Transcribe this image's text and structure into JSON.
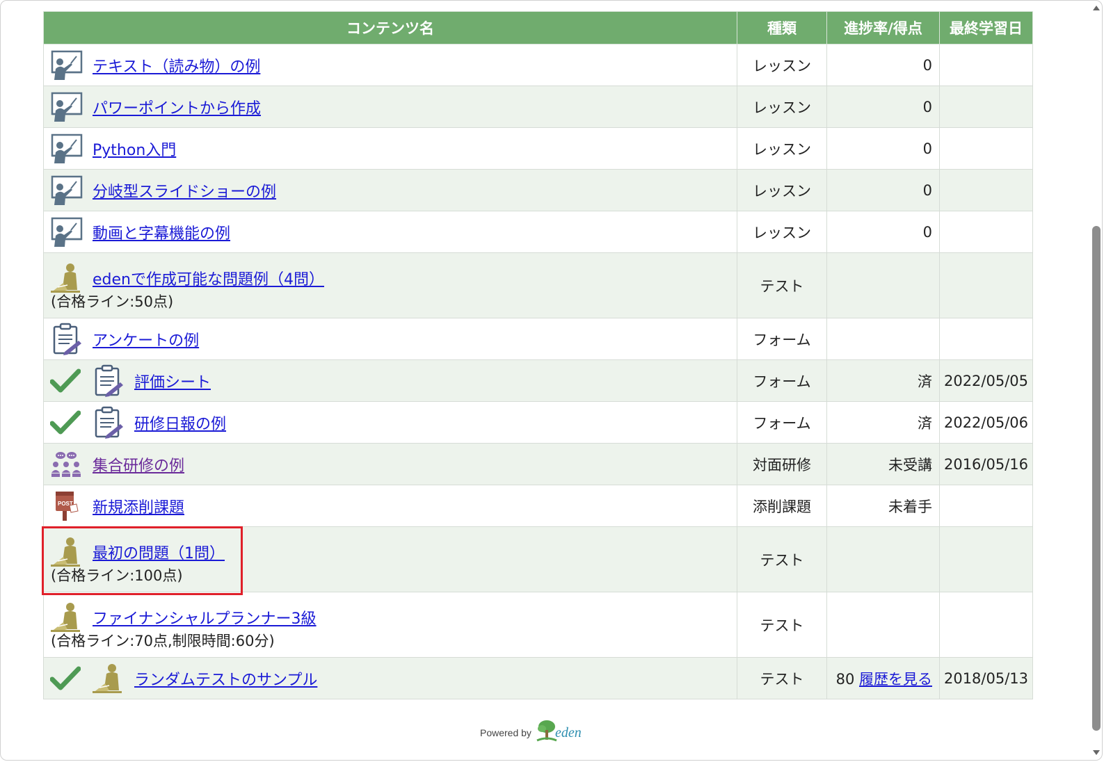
{
  "table": {
    "headers": {
      "name": "コンテンツ名",
      "type": "種類",
      "progress": "進捗率/得点",
      "last_date": "最終学習日"
    },
    "rows": [
      {
        "icon": "lesson-icon",
        "name": "テキスト（読み物）の例",
        "condition": "",
        "type": "レッスン",
        "progress": "0",
        "history_link": "",
        "date": "",
        "completed": false
      },
      {
        "icon": "lesson-icon",
        "name": "パワーポイントから作成",
        "condition": "",
        "type": "レッスン",
        "progress": "0",
        "history_link": "",
        "date": "",
        "completed": false
      },
      {
        "icon": "lesson-icon",
        "name": "Python入門",
        "condition": "",
        "type": "レッスン",
        "progress": "0",
        "history_link": "",
        "date": "",
        "completed": false
      },
      {
        "icon": "lesson-icon",
        "name": "分岐型スライドショーの例",
        "condition": "",
        "type": "レッスン",
        "progress": "0",
        "history_link": "",
        "date": "",
        "completed": false
      },
      {
        "icon": "lesson-icon",
        "name": "動画と字幕機能の例",
        "condition": "",
        "type": "レッスン",
        "progress": "0",
        "history_link": "",
        "date": "",
        "completed": false
      },
      {
        "icon": "test-icon",
        "name": "edenで作成可能な問題例（4問）",
        "condition": "(合格ライン:50点)",
        "type": "テスト",
        "progress": "",
        "history_link": "",
        "date": "",
        "completed": false
      },
      {
        "icon": "form-icon",
        "name": "アンケートの例",
        "condition": "",
        "type": "フォーム",
        "progress": "",
        "history_link": "",
        "date": "",
        "completed": false
      },
      {
        "icon": "form-icon",
        "name": "評価シート",
        "condition": "",
        "type": "フォーム",
        "progress": "済",
        "history_link": "",
        "date": "2022/05/05",
        "completed": true
      },
      {
        "icon": "form-icon",
        "name": "研修日報の例",
        "condition": "",
        "type": "フォーム",
        "progress": "済",
        "history_link": "",
        "date": "2022/05/06",
        "completed": true
      },
      {
        "icon": "group-training-icon",
        "name": "集合研修の例",
        "condition": "",
        "type": "対面研修",
        "progress": "未受講",
        "history_link": "",
        "date": "2016/05/16",
        "completed": false
      },
      {
        "icon": "post-icon",
        "name": "新規添削課題",
        "condition": "",
        "type": "添削課題",
        "progress": "未着手",
        "history_link": "",
        "date": "",
        "completed": false
      },
      {
        "icon": "test-icon",
        "name": "最初の問題（1問）",
        "condition": "(合格ライン:100点)",
        "type": "テスト",
        "progress": "",
        "history_link": "",
        "date": "",
        "completed": false
      },
      {
        "icon": "test-icon",
        "name": "ファイナンシャルプランナー3級",
        "condition": "(合格ライン:70点,制限時間:60分)",
        "type": "テスト",
        "progress": "",
        "history_link": "",
        "date": "",
        "completed": false
      },
      {
        "icon": "test-icon",
        "name": "ランダムテストのサンプル",
        "condition": "",
        "type": "テスト",
        "progress": "80",
        "history_link": "履歴を見る",
        "date": "2018/05/13",
        "completed": true
      }
    ]
  },
  "footer": {
    "powered_by": "Powered by",
    "brand": "eden"
  },
  "colors": {
    "header_green": "#70ac6e",
    "check_green": "#4e9a54",
    "highlight_red": "#e0202a",
    "link_blue": "#1a1ad6"
  }
}
